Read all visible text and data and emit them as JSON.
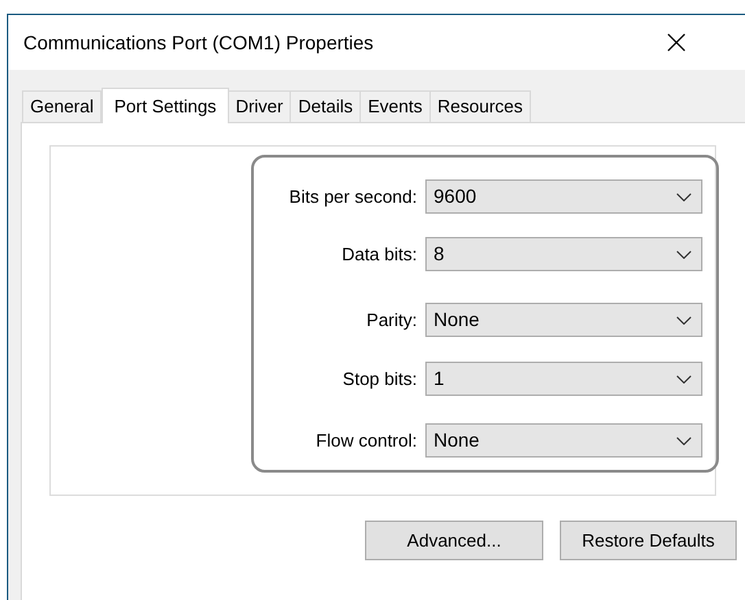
{
  "window": {
    "title": "Communications Port (COM1) Properties"
  },
  "tabs": [
    {
      "label": "General",
      "selected": false
    },
    {
      "label": "Port Settings",
      "selected": true
    },
    {
      "label": "Driver",
      "selected": false
    },
    {
      "label": "Details",
      "selected": false
    },
    {
      "label": "Events",
      "selected": false
    },
    {
      "label": "Resources",
      "selected": false
    }
  ],
  "settings": [
    {
      "label": "Bits per second:",
      "value": "9600"
    },
    {
      "label": "Data bits:",
      "value": "8"
    },
    {
      "label": "Parity:",
      "value": "None"
    },
    {
      "label": "Stop bits:",
      "value": "1"
    },
    {
      "label": "Flow control:",
      "value": "None"
    }
  ],
  "buttons": [
    "Advanced...",
    "Restore Defaults"
  ]
}
